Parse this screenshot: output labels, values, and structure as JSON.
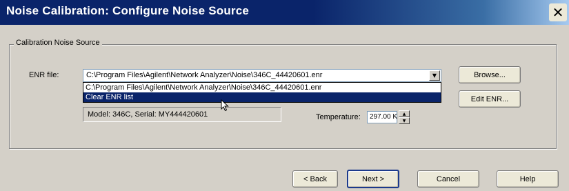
{
  "window": {
    "title": "Noise Calibration: Configure Noise Source",
    "close_glyph": "✕"
  },
  "group": {
    "legend": "Calibration Noise Source"
  },
  "enr": {
    "label": "ENR file:",
    "selected_value": "C:\\Program Files\\Agilent\\Network Analyzer\\Noise\\346C_44420601.enr",
    "dropdown_options": [
      "C:\\Program Files\\Agilent\\Network Analyzer\\Noise\\346C_44420601.enr",
      "Clear ENR list"
    ],
    "highlighted_index": 1
  },
  "model_info": "Model: 346C, Serial: MY444420601",
  "temperature": {
    "label": "Temperature:",
    "value": "297.00 K"
  },
  "buttons": {
    "browse": "Browse...",
    "edit_enr": "Edit ENR...",
    "back": "< Back",
    "next": "Next >",
    "cancel": "Cancel",
    "help": "Help"
  },
  "colors": {
    "title_bar": "#0a246a",
    "selection": "#0a246a",
    "dialog_bg": "#d4d0c8"
  }
}
